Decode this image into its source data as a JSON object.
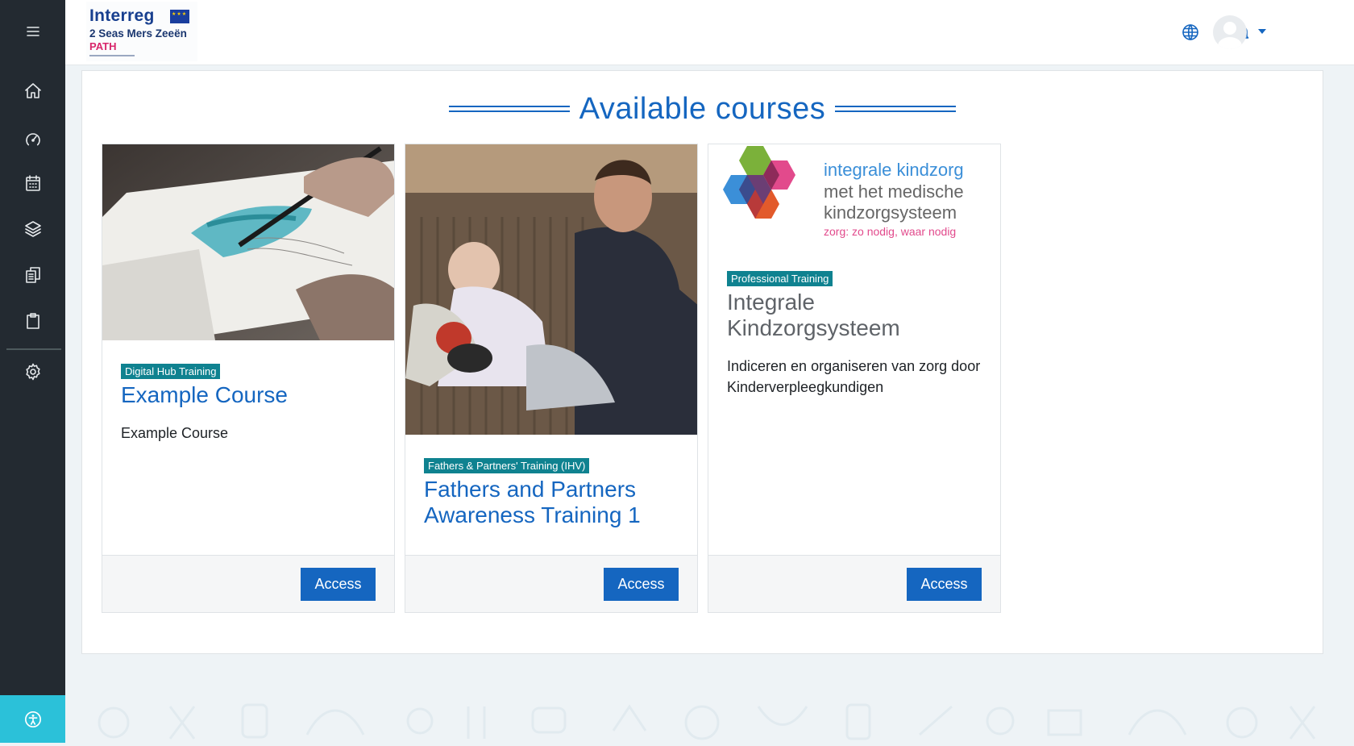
{
  "sidebar": {
    "menu_icon": "hamburger-menu-icon",
    "items": [
      {
        "icon": "home-icon"
      },
      {
        "icon": "dashboard-gauge-icon"
      },
      {
        "icon": "calendar-icon"
      },
      {
        "icon": "layers-icon"
      },
      {
        "icon": "files-icon"
      },
      {
        "icon": "clipboard-icon"
      },
      {
        "icon": "gear-icon"
      }
    ],
    "accessibility_icon": "accessibility-icon"
  },
  "header": {
    "logo": {
      "line1": "Interreg",
      "line2": "2 Seas Mers Zeeën",
      "line3": "PATH"
    },
    "icons": [
      "globe-icon",
      "bell-icon",
      "avatar",
      "chevron-down-icon"
    ]
  },
  "main": {
    "title": "Available courses",
    "courses": [
      {
        "category": "Digital Hub Training",
        "title": "Example Course",
        "description": "Example Course",
        "button": "Access",
        "title_color": "#1566c0"
      },
      {
        "category": "Fathers & Partners' Training (IHV)",
        "title": "Fathers and Partners Awareness Training 1",
        "description": "",
        "button": "Access",
        "title_color": "#1566c0"
      },
      {
        "category": "Professional Training",
        "title": "Integrale Kindzorgsysteem",
        "description": "Indiceren en organiseren van zorg door Kinderverpleegkundigen",
        "button": "Access",
        "title_color": "#5f6368",
        "image_text": {
          "line1": "integrale kindzorg",
          "line2": "met het medische",
          "line3": "kindzorgsysteem",
          "line4": "zorg: zo nodig, waar nodig"
        }
      }
    ]
  },
  "colors": {
    "primary": "#1566c0",
    "badge": "#0f8290",
    "sidebar": "#232a31",
    "accessibility": "#2bc1d9"
  }
}
